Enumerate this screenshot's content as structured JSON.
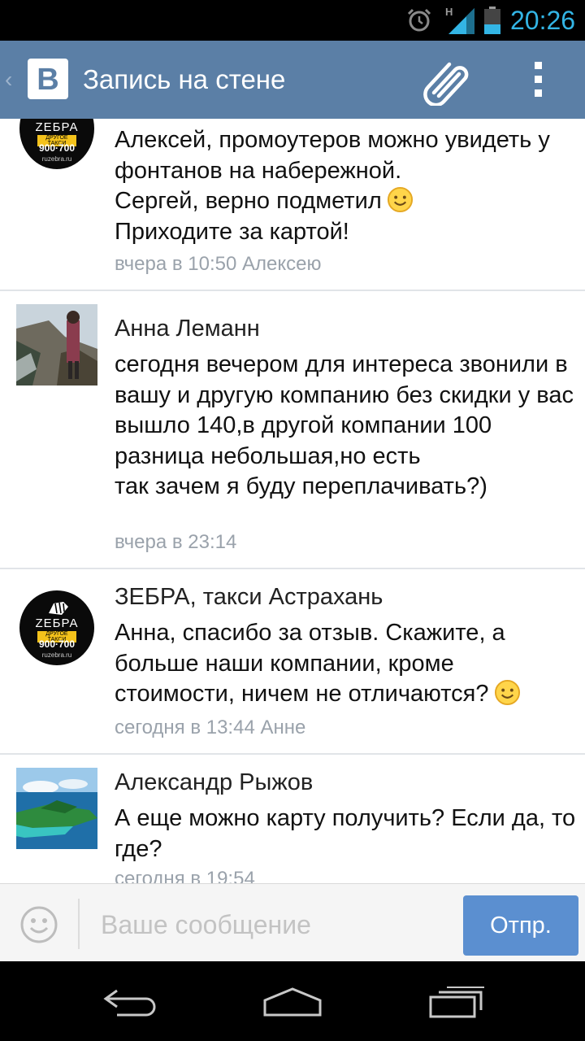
{
  "status_bar": {
    "time": "20:26",
    "network_label": "H"
  },
  "header": {
    "logo_letter": "В",
    "title": "Запись на стене"
  },
  "avatars": {
    "zebra": {
      "name": "ZEБРА",
      "tagline": "ДРУГОЕ ТАКСИ",
      "phone": "900·700",
      "url": "ruzebra.ru"
    }
  },
  "comments": [
    {
      "author": "",
      "text": "Алексей, промоутеров можно увидеть у фонтанов на набережной.\nСергей, верно подметил",
      "text_after": "Приходите за картой!",
      "meta": "вчера в 10:50 Алексею",
      "avatar": "zebra-logo"
    },
    {
      "author": "Анна Леманн",
      "text": "сегодня вечером для интереса звонили в вашу и другую компанию без скидки у вас вышло 140,в другой компании 100\nразница небольшая,но есть\nтак зачем я буду переплачивать?)",
      "meta": "вчера в 23:14",
      "avatar": "photo-coast"
    },
    {
      "author": "ЗЕБРА, такси Астрахань",
      "text": "Анна, спасибо за отзыв. Скажите, а больше наши компании, кроме стоимости, ничем не отличаются?",
      "meta": "сегодня в 13:44 Анне",
      "avatar": "zebra-logo"
    },
    {
      "author": "Александр Рыжов",
      "text": "А еще можно карту получить? Если да, то где?",
      "meta": "сегодня в 19:54",
      "avatar": "photo-island"
    }
  ],
  "composer": {
    "placeholder": "Ваше сообщение",
    "value": "",
    "send_label": "Отпр."
  },
  "icons": {
    "alarm": "alarm-clock-icon",
    "signal": "signal-icon",
    "battery": "battery-icon",
    "attach": "paperclip-icon",
    "overflow": "overflow-menu-icon",
    "emoji": "smiley-icon",
    "nav_back": "back-arrow-icon",
    "nav_home": "home-icon",
    "nav_recent": "recent-apps-icon"
  },
  "colors": {
    "header_bg": "#5b7fa6",
    "time": "#33b5e5",
    "send_button": "#5b8fd0",
    "meta_text": "#9aa2ab"
  }
}
